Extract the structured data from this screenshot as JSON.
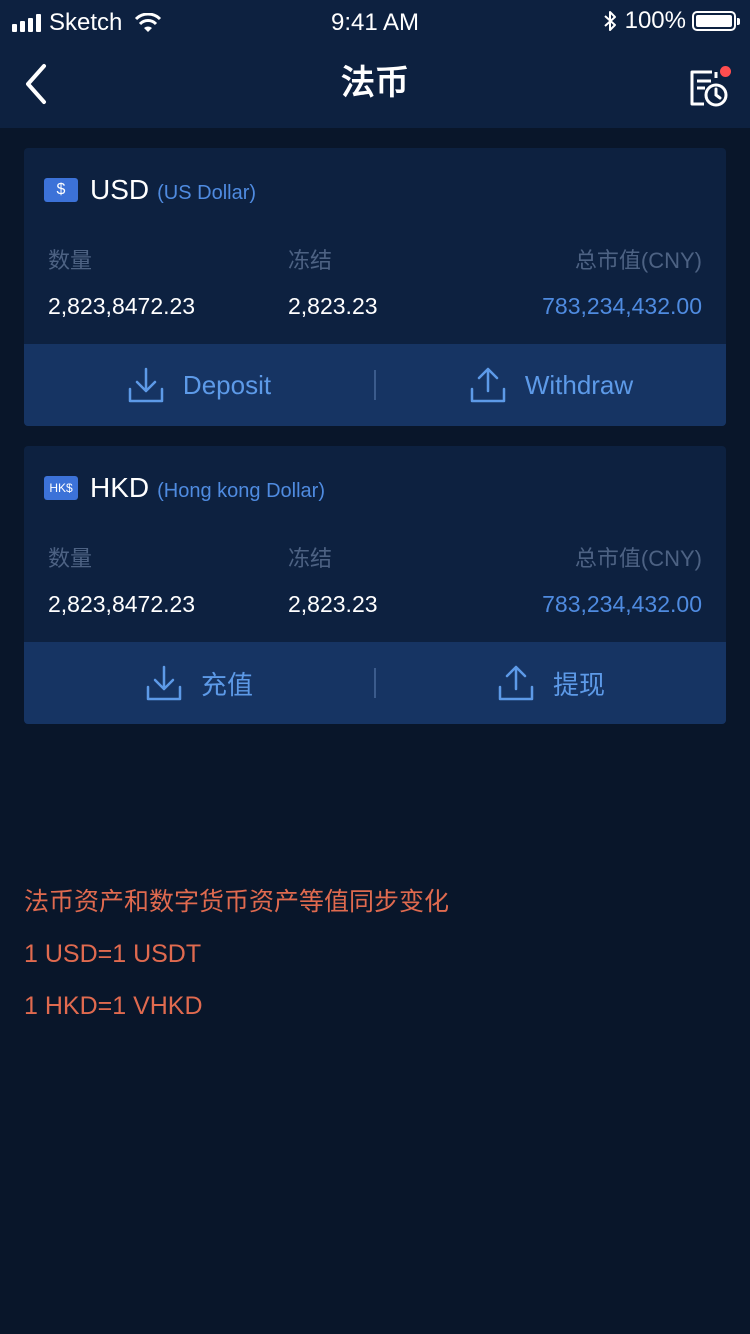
{
  "status_bar": {
    "carrier": "Sketch",
    "time": "9:41 AM",
    "battery": "100%"
  },
  "nav": {
    "title": "法币"
  },
  "cards": [
    {
      "badge": "$",
      "code": "USD",
      "name": "(US Dollar)",
      "labels": {
        "quantity": "数量",
        "frozen": "冻结",
        "total": "总市值(CNY)"
      },
      "values": {
        "quantity": "2,823,8472.23",
        "frozen": "2,823.23",
        "total": "783,234,432.00"
      },
      "actions": {
        "deposit": "Deposit",
        "withdraw": "Withdraw"
      }
    },
    {
      "badge": "HK$",
      "code": "HKD",
      "name": "(Hong kong Dollar)",
      "labels": {
        "quantity": "数量",
        "frozen": "冻结",
        "total": "总市值(CNY)"
      },
      "values": {
        "quantity": "2,823,8472.23",
        "frozen": "2,823.23",
        "total": "783,234,432.00"
      },
      "actions": {
        "deposit": "充值",
        "withdraw": "提现"
      }
    }
  ],
  "notes": [
    "法币资产和数字货币资产等值同步变化",
    "1 USD=1 USDT",
    "1 HKD=1 VHKD"
  ],
  "colors": {
    "background": "#09162a",
    "card": "#0d2140",
    "action_bar": "#163463",
    "accent": "#4f8be0",
    "note": "#e06a4f",
    "dot": "#ff4d4f"
  }
}
